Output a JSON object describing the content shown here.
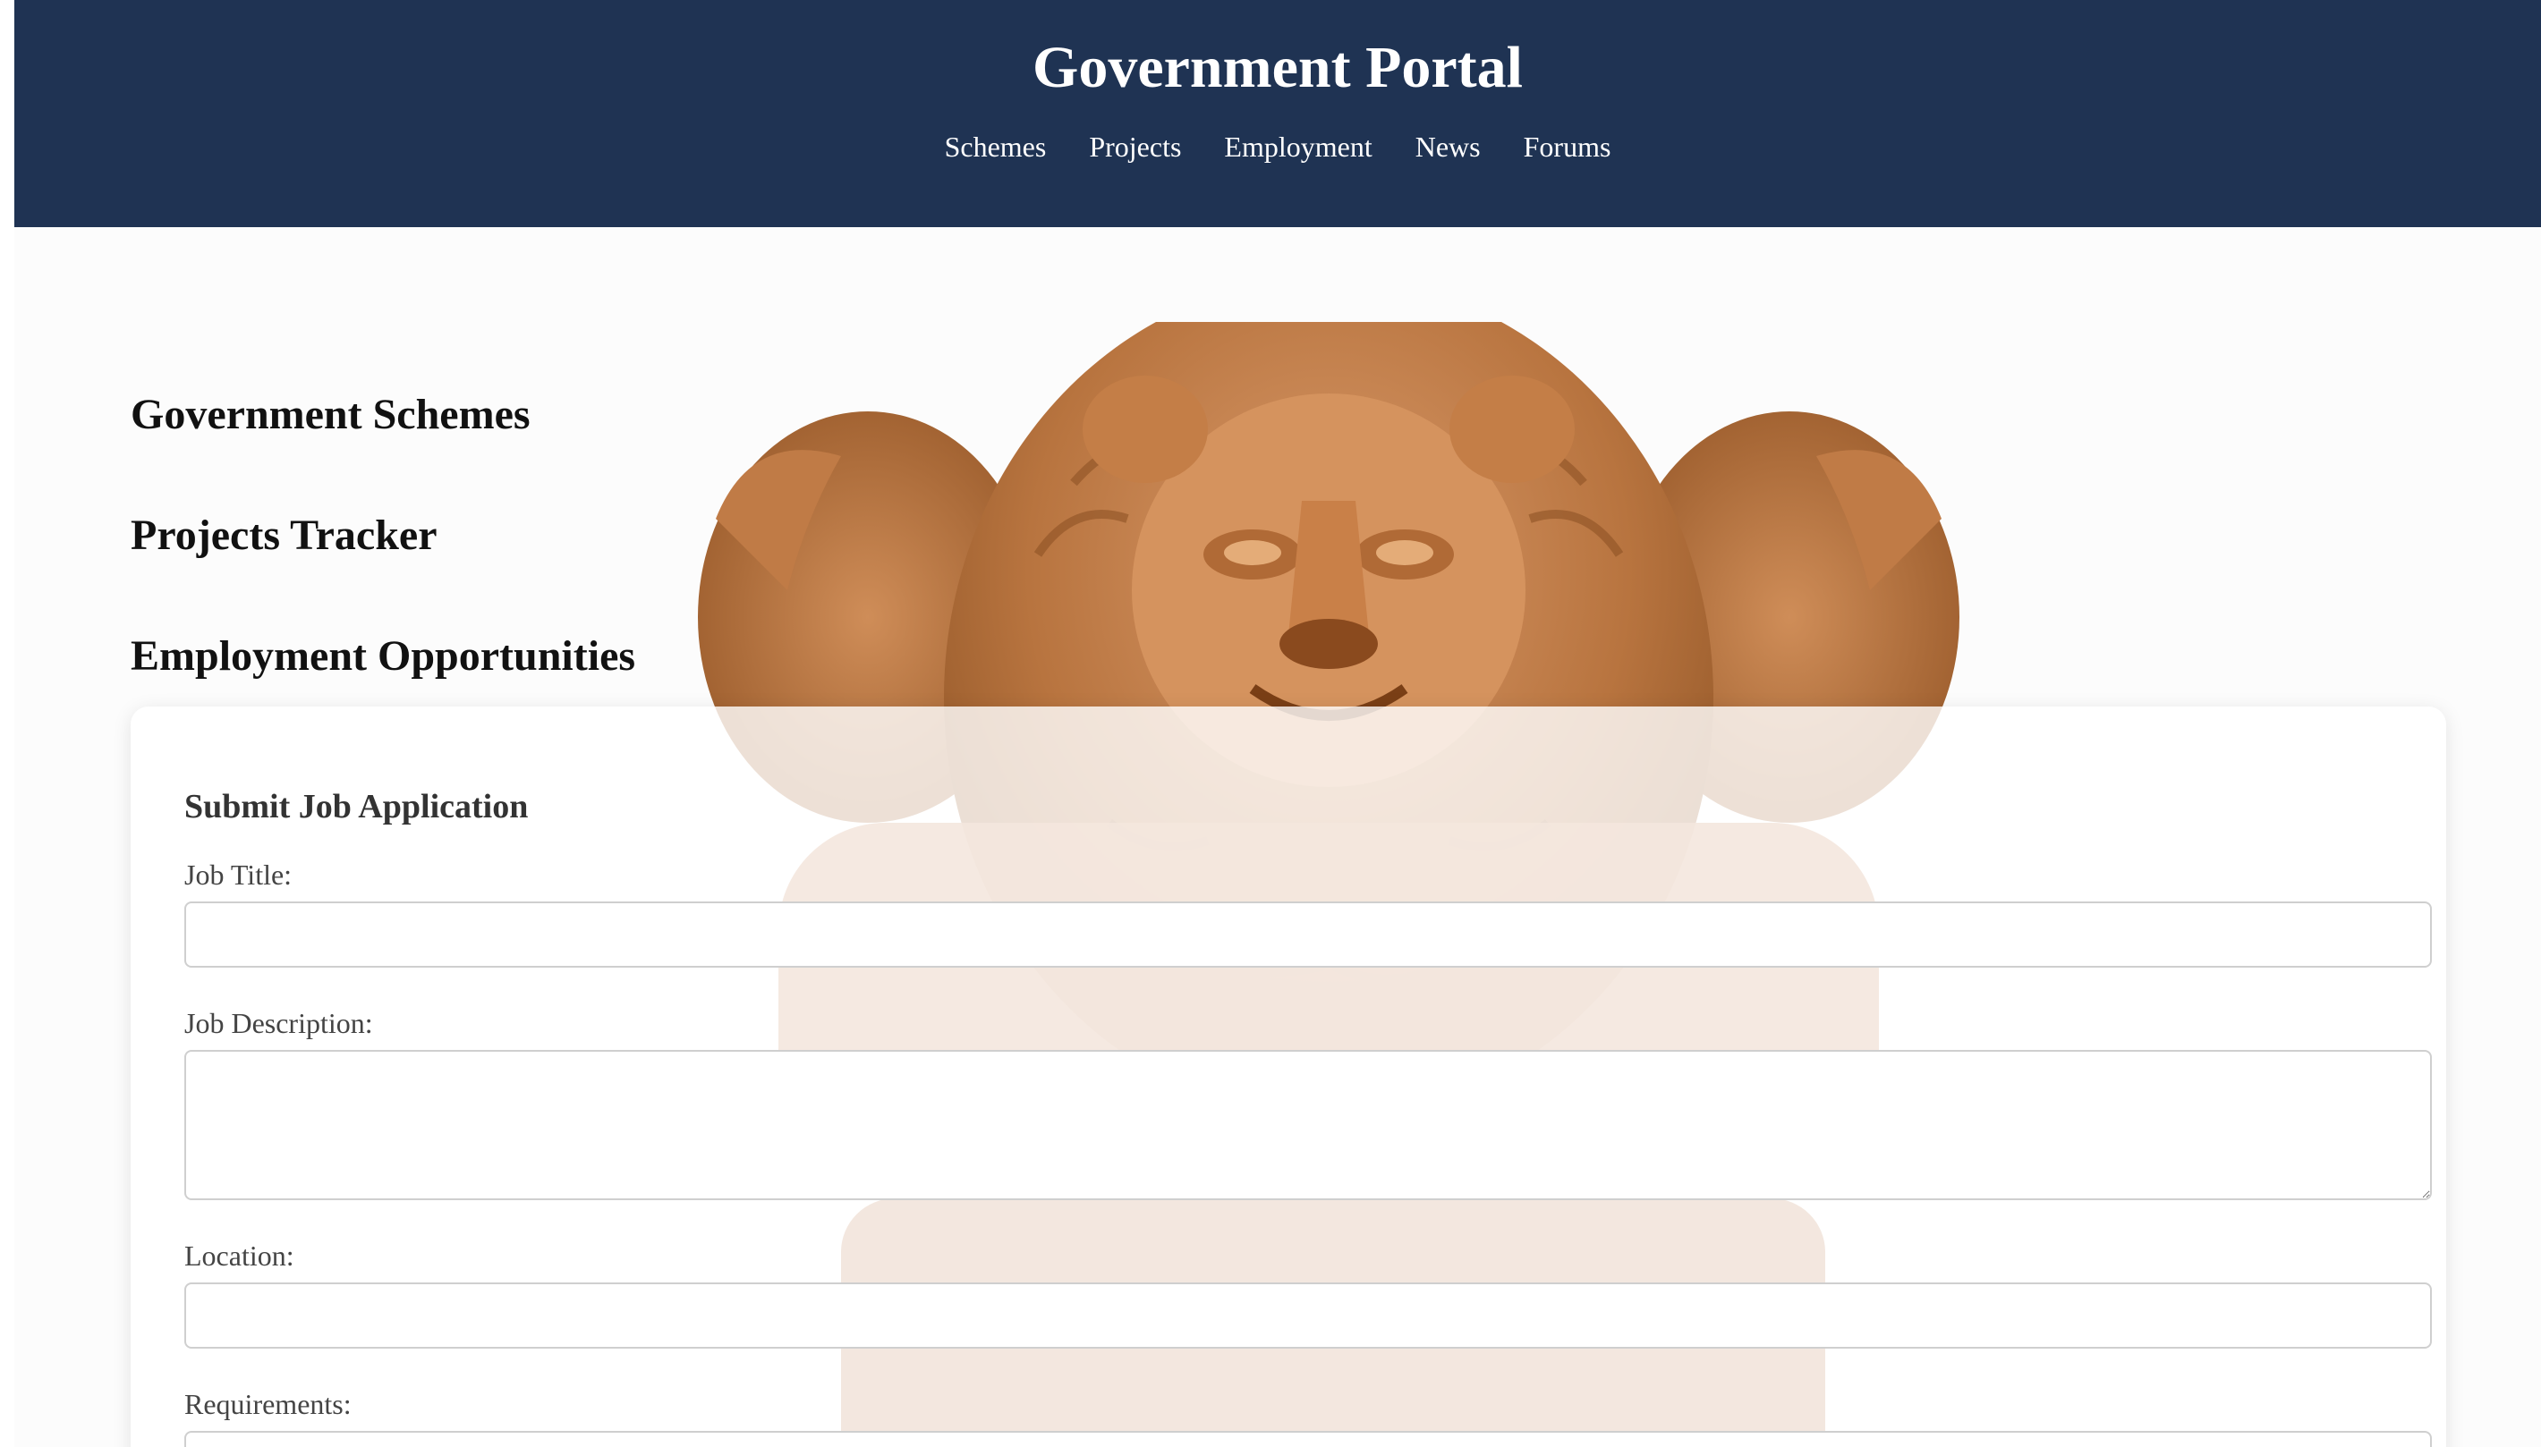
{
  "header": {
    "title": "Government Portal",
    "nav": [
      "Schemes",
      "Projects",
      "Employment",
      "News",
      "Forums"
    ]
  },
  "sections": {
    "schemes_heading": "Government Schemes",
    "projects_heading": "Projects Tracker",
    "employment_heading": "Employment Opportunities"
  },
  "form": {
    "title": "Submit Job Application",
    "job_title_label": "Job Title:",
    "job_title_value": "",
    "job_description_label": "Job Description:",
    "job_description_value": "",
    "location_label": "Location:",
    "location_value": "",
    "requirements_label": "Requirements:",
    "requirements_value": ""
  },
  "colors": {
    "header_bg": "#1f3353",
    "header_text": "#ffffff",
    "heading_text": "#111111",
    "label_text": "#444444"
  },
  "icons": {
    "background_image": "lion-capital-illustration"
  }
}
